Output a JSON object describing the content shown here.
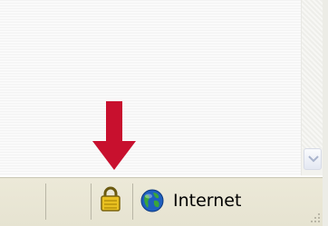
{
  "statusbar": {
    "zone_label": "Internet",
    "security_icon": "lock-icon",
    "zone_icon": "globe-icon"
  },
  "annotation": {
    "icon": "arrow-down-icon",
    "color": "#c8102e"
  },
  "scrollbar": {
    "down_icon": "chevron-down-icon"
  },
  "colors": {
    "statusbar_bg": "#ece9d8",
    "content_bg": "#f7f7f7",
    "lock_gold": "#e8c020"
  }
}
